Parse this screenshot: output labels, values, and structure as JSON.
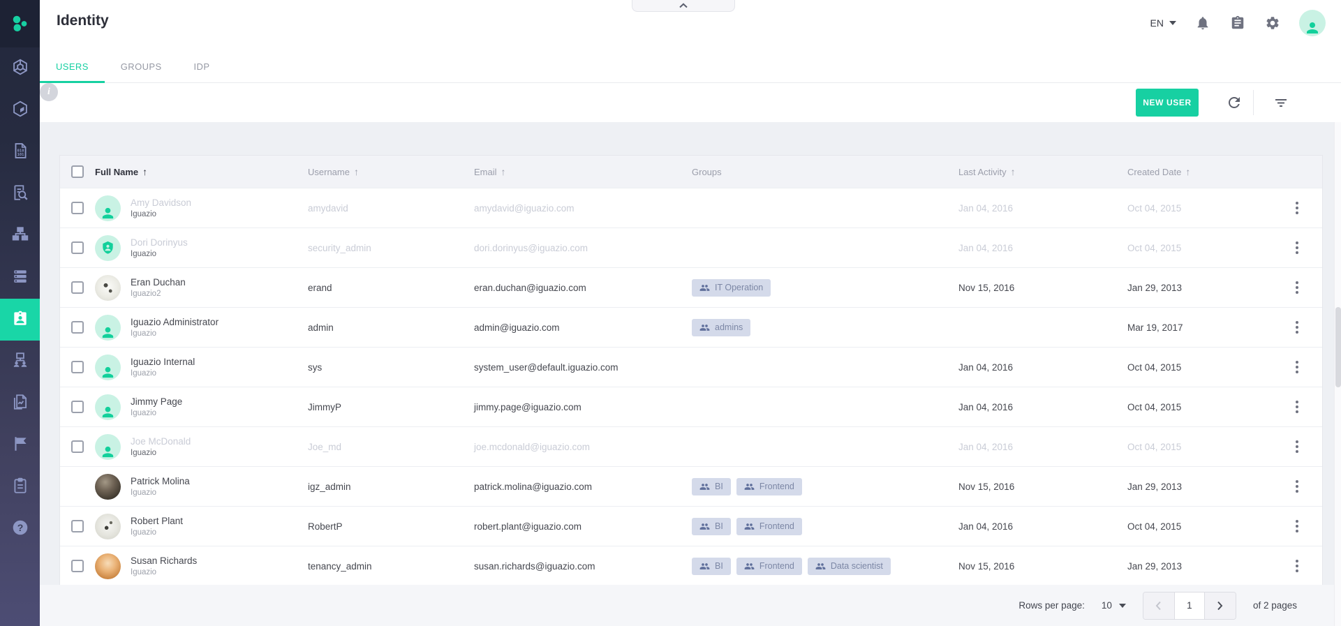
{
  "app": {
    "title": "Identity"
  },
  "topbar": {
    "language": "EN",
    "icons": [
      "notifications-bell-icon",
      "tasks-clipboard-icon",
      "settings-gear-icon",
      "user-avatar"
    ],
    "collapse_control": "chevron-up"
  },
  "tabs": [
    {
      "label": "USERS",
      "active": true
    },
    {
      "label": "GROUPS",
      "active": false
    },
    {
      "label": "IDP",
      "active": false
    }
  ],
  "toolbar": {
    "new_user_label": "NEW USER",
    "icons": [
      "refresh-icon",
      "filter-icon",
      "info-icon"
    ],
    "info_glyph": "i"
  },
  "sidebar": {
    "active_index": 6,
    "items": [
      {
        "icon": "services-hexagon-icon"
      },
      {
        "icon": "containers-box-icon"
      },
      {
        "icon": "data-binary-file-icon"
      },
      {
        "icon": "browse-document-search-icon"
      },
      {
        "icon": "network-monitors-icon"
      },
      {
        "icon": "storage-servers-icon"
      },
      {
        "icon": "identity-badge-icon"
      },
      {
        "icon": "org-users-monitor-icon"
      },
      {
        "icon": "reports-documents-icon"
      },
      {
        "icon": "flag-icon"
      },
      {
        "icon": "events-clipboard-icon"
      },
      {
        "icon": "help-question-icon"
      }
    ]
  },
  "table": {
    "columns": [
      {
        "label": "Full Name",
        "sortable": true,
        "sort_arrow": "↑",
        "primary": true
      },
      {
        "label": "Username",
        "sortable": true,
        "sort_arrow": "↑",
        "primary": false
      },
      {
        "label": "Email",
        "sortable": true,
        "sort_arrow": "↑",
        "primary": false
      },
      {
        "label": "Groups",
        "sortable": false,
        "sort_arrow": "",
        "primary": false
      },
      {
        "label": "Last Activity",
        "sortable": true,
        "sort_arrow": "↑",
        "primary": false
      },
      {
        "label": "Created Date",
        "sortable": true,
        "sort_arrow": "↑",
        "primary": false
      }
    ],
    "rows": [
      {
        "full_name": "Amy Davidson",
        "tenant": "Iguazio",
        "username": "amydavid",
        "email": "amydavid@iguazio.com",
        "groups": [],
        "last_activity": "Jan 04, 2016",
        "created_date": "Oct 04, 2015",
        "disabled": true,
        "avatar": "teal-person",
        "has_checkbox": true
      },
      {
        "full_name": "Dori Dorinyus",
        "tenant": "Iguazio",
        "username": "security_admin",
        "email": "dori.dorinyus@iguazio.com",
        "groups": [],
        "last_activity": "Jan 04, 2016",
        "created_date": "Oct 04, 2015",
        "disabled": true,
        "avatar": "teal-person-shield",
        "has_checkbox": true
      },
      {
        "full_name": "Eran Duchan",
        "tenant": "Iguazio2",
        "username": "erand",
        "email": "eran.duchan@iguazio.com",
        "groups": [
          "IT Operation"
        ],
        "last_activity": "Nov 15, 2016",
        "created_date": "Jan 29, 2013",
        "disabled": false,
        "avatar": "photo-dandelion",
        "has_checkbox": true
      },
      {
        "full_name": "Iguazio Administrator",
        "tenant": "Iguazio",
        "username": "admin",
        "email": "admin@iguazio.com",
        "groups": [
          "admins"
        ],
        "last_activity": "",
        "created_date": "Mar 19, 2017",
        "disabled": false,
        "avatar": "teal-person",
        "has_checkbox": true
      },
      {
        "full_name": "Iguazio Internal",
        "tenant": "Iguazio",
        "username": "sys",
        "email": "system_user@default.iguazio.com",
        "groups": [],
        "last_activity": "Jan 04, 2016",
        "created_date": "Oct 04, 2015",
        "disabled": false,
        "avatar": "teal-person",
        "has_checkbox": true
      },
      {
        "full_name": "Jimmy Page",
        "tenant": "Iguazio",
        "username": "JimmyP",
        "email": "jimmy.page@iguazio.com",
        "groups": [],
        "last_activity": "Jan 04, 2016",
        "created_date": "Oct 04, 2015",
        "disabled": false,
        "avatar": "teal-person",
        "has_checkbox": true
      },
      {
        "full_name": "Joe McDonald",
        "tenant": "Iguazio",
        "username": "Joe_md",
        "email": "joe.mcdonald@iguazio.com",
        "groups": [],
        "last_activity": "Jan 04, 2016",
        "created_date": "Oct 04, 2015",
        "disabled": true,
        "avatar": "teal-person",
        "has_checkbox": true
      },
      {
        "full_name": "Patrick Molina",
        "tenant": "Iguazio",
        "username": "igz_admin",
        "email": "patrick.molina@iguazio.com",
        "groups": [
          "BI",
          "Frontend"
        ],
        "last_activity": "Nov 15, 2016",
        "created_date": "Jan 29, 2013",
        "disabled": false,
        "avatar": "photo-portrait",
        "has_checkbox": false
      },
      {
        "full_name": "Robert Plant",
        "tenant": "Iguazio",
        "username": "RobertP",
        "email": "robert.plant@iguazio.com",
        "groups": [
          "BI",
          "Frontend"
        ],
        "last_activity": "Jan 04, 2016",
        "created_date": "Oct 04, 2015",
        "disabled": false,
        "avatar": "photo-dandelion2",
        "has_checkbox": true
      },
      {
        "full_name": "Susan Richards",
        "tenant": "Iguazio",
        "username": "tenancy_admin",
        "email": "susan.richards@iguazio.com",
        "groups": [
          "BI",
          "Frontend",
          "Data scientist"
        ],
        "last_activity": "Nov 15, 2016",
        "created_date": "Jan 29, 2013",
        "disabled": false,
        "avatar": "photo-squirrel",
        "has_checkbox": true
      }
    ]
  },
  "pagination": {
    "rows_per_page_label": "Rows per page:",
    "rows_per_page_value": "10",
    "current_page": "1",
    "pages_label": "of 2 pages"
  },
  "colors": {
    "accent_teal": "#17d0a2",
    "sidebar_top": "#23283c",
    "sidebar_bottom": "#4d4d74",
    "sidebar_icon": "#8d97c4",
    "chip_bg": "#d4daea",
    "chip_text": "#7c87a5",
    "header_bg": "#f2f3f7",
    "page_bg": "#eef0f4",
    "disabled_text": "#c9ccd6",
    "avatar_bg": "#c9f2e4"
  }
}
